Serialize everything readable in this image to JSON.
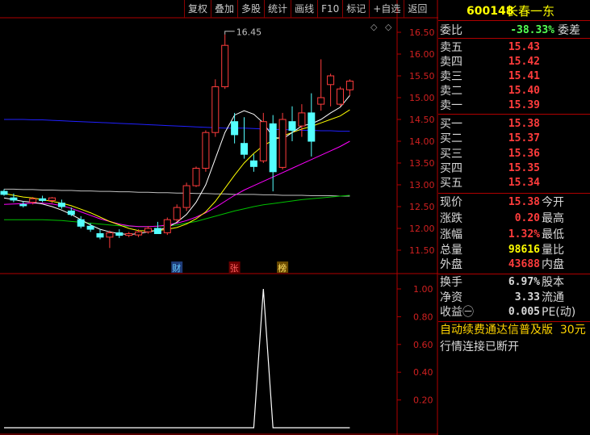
{
  "toolbar": [
    "复权",
    "叠加",
    "多股",
    "统计",
    "画线",
    "F10",
    "标记",
    "+自选",
    "返回"
  ],
  "stock": {
    "code": "600148",
    "name": "长春一东"
  },
  "weibi": {
    "label": "委比",
    "value": "-38.33%",
    "label2": "委差"
  },
  "sells": [
    {
      "label": "卖五",
      "price": "15.43"
    },
    {
      "label": "卖四",
      "price": "15.42"
    },
    {
      "label": "卖三",
      "price": "15.41"
    },
    {
      "label": "卖二",
      "price": "15.40"
    },
    {
      "label": "卖一",
      "price": "15.39"
    }
  ],
  "buys": [
    {
      "label": "买一",
      "price": "15.38"
    },
    {
      "label": "买二",
      "price": "15.37"
    },
    {
      "label": "买三",
      "price": "15.36"
    },
    {
      "label": "买四",
      "price": "15.35"
    },
    {
      "label": "买五",
      "price": "15.34"
    }
  ],
  "quote": [
    {
      "label": "现价",
      "value": "15.38",
      "label2": "今开"
    },
    {
      "label": "涨跌",
      "value": "0.20",
      "label2": "最高"
    },
    {
      "label": "涨幅",
      "value": "1.32%",
      "label2": "最低"
    },
    {
      "label": "总量",
      "value": "98616",
      "label2": "量比"
    },
    {
      "label": "外盘",
      "value": "43688",
      "label2": "内盘"
    }
  ],
  "fund": [
    {
      "label": "换手",
      "value": "6.97%",
      "label2": "股本"
    },
    {
      "label": "净资",
      "value": "3.33",
      "label2": "流通"
    },
    {
      "label": "收益㊀",
      "value": "0.005",
      "label2": "PE(动)"
    }
  ],
  "banner": "自动续费通达信普及版  30元",
  "status": "行情连接已断开",
  "peak_label": "16.45",
  "markers": [
    "财",
    "张",
    "榜"
  ],
  "colors": {
    "up": "#ff3c3c",
    "down": "#54ffff",
    "ma5": "#ffffff",
    "ma10": "#ffff00",
    "ma20": "#ff00ff",
    "ma60": "#00c000",
    "ma120": "#2020ff",
    "ma250": "#c0c0c0"
  },
  "chart_data": [
    {
      "type": "candlestick",
      "ylim": [
        11.25,
        16.7
      ],
      "yticks": [
        "16.50",
        "16.00",
        "15.50",
        "15.00",
        "14.50",
        "14.00",
        "13.50",
        "13.00",
        "12.50",
        "12.00",
        "11.50"
      ],
      "candles": [
        [
          12.85,
          12.9,
          12.75,
          12.78
        ],
        [
          12.7,
          12.8,
          12.6,
          12.65
        ],
        [
          12.55,
          12.62,
          12.48,
          12.52
        ],
        [
          12.6,
          12.72,
          12.55,
          12.68
        ],
        [
          12.68,
          12.75,
          12.6,
          12.64
        ],
        [
          12.64,
          12.72,
          12.58,
          12.7
        ],
        [
          12.58,
          12.66,
          12.45,
          12.5
        ],
        [
          12.4,
          12.48,
          12.28,
          12.32
        ],
        [
          12.2,
          12.28,
          12.0,
          12.05
        ],
        [
          12.05,
          12.12,
          11.92,
          11.98
        ],
        [
          11.88,
          11.98,
          11.75,
          11.8
        ],
        [
          11.8,
          11.95,
          11.55,
          11.9
        ],
        [
          11.9,
          11.98,
          11.78,
          11.84
        ],
        [
          11.84,
          11.92,
          11.8,
          11.88
        ],
        [
          11.85,
          11.98,
          11.8,
          11.92
        ],
        [
          11.92,
          12.05,
          11.88,
          12.0
        ],
        [
          12.0,
          12.15,
          11.9,
          11.88
        ],
        [
          11.9,
          12.25,
          11.85,
          12.2
        ],
        [
          12.2,
          12.55,
          12.15,
          12.48
        ],
        [
          12.48,
          13.05,
          12.4,
          12.98
        ],
        [
          12.98,
          13.42,
          12.95,
          13.38
        ],
        [
          13.38,
          14.25,
          13.3,
          14.2
        ],
        [
          14.2,
          15.42,
          14.1,
          15.25
        ],
        [
          15.25,
          16.45,
          15.2,
          16.2
        ],
        [
          14.45,
          14.65,
          13.95,
          14.15
        ],
        [
          13.95,
          14.55,
          13.6,
          13.7
        ],
        [
          13.55,
          13.7,
          13.3,
          13.42
        ],
        [
          13.55,
          14.65,
          13.5,
          14.45
        ],
        [
          14.4,
          14.6,
          12.85,
          13.3
        ],
        [
          13.4,
          14.65,
          13.35,
          14.5
        ],
        [
          14.45,
          14.8,
          14.0,
          14.25
        ],
        [
          14.35,
          14.85,
          14.1,
          14.65
        ],
        [
          14.65,
          15.1,
          13.65,
          14.0
        ],
        [
          14.85,
          15.88,
          14.7,
          15.0
        ],
        [
          15.3,
          15.55,
          14.8,
          15.5
        ],
        [
          14.85,
          15.25,
          14.8,
          15.2
        ],
        [
          15.18,
          15.42,
          15.05,
          15.38
        ]
      ],
      "ma5": [
        12.7,
        12.66,
        12.62,
        12.6,
        12.56,
        12.5,
        12.42,
        12.32,
        12.2,
        12.08,
        11.98,
        11.92,
        11.88,
        11.86,
        11.88,
        11.92,
        11.96,
        12.02,
        12.14,
        12.32,
        12.6,
        13.0,
        13.6,
        14.2,
        14.6,
        14.7,
        14.62,
        14.42,
        14.1,
        14.05,
        14.2,
        14.35,
        14.4,
        14.5,
        14.65,
        14.78,
        15.05
      ],
      "ma10": [
        12.8,
        12.76,
        12.72,
        12.7,
        12.66,
        12.62,
        12.58,
        12.52,
        12.44,
        12.36,
        12.26,
        12.16,
        12.08,
        12.0,
        11.95,
        11.94,
        11.95,
        11.98,
        12.02,
        12.1,
        12.22,
        12.38,
        12.62,
        12.92,
        13.22,
        13.5,
        13.72,
        13.9,
        14.02,
        14.12,
        14.2,
        14.28,
        14.34,
        14.42,
        14.5,
        14.58,
        14.72
      ],
      "ma20": [
        12.55,
        12.56,
        12.57,
        12.58,
        12.58,
        12.56,
        12.52,
        12.46,
        12.38,
        12.3,
        12.22,
        12.16,
        12.1,
        12.06,
        12.04,
        12.04,
        12.05,
        12.08,
        12.12,
        12.18,
        12.26,
        12.36,
        12.48,
        12.62,
        12.76,
        12.88,
        12.98,
        13.08,
        13.18,
        13.28,
        13.38,
        13.48,
        13.58,
        13.68,
        13.78,
        13.88,
        14.0
      ],
      "ma60": [
        12.2,
        12.2,
        12.2,
        12.2,
        12.2,
        12.19,
        12.18,
        12.16,
        12.14,
        12.12,
        12.1,
        12.08,
        12.06,
        12.05,
        12.04,
        12.04,
        12.05,
        12.06,
        12.08,
        12.12,
        12.16,
        12.22,
        12.28,
        12.34,
        12.4,
        12.45,
        12.5,
        12.54,
        12.57,
        12.6,
        12.63,
        12.66,
        12.68,
        12.7,
        12.72,
        12.74,
        12.76
      ],
      "ma120": [
        14.5,
        14.5,
        14.5,
        14.49,
        14.49,
        14.48,
        14.47,
        14.46,
        14.45,
        14.44,
        14.43,
        14.42,
        14.41,
        14.4,
        14.39,
        14.38,
        14.37,
        14.36,
        14.35,
        14.34,
        14.33,
        14.32,
        14.31,
        14.3,
        14.3,
        14.3,
        14.29,
        14.28,
        14.27,
        14.27,
        14.26,
        14.25,
        14.25,
        14.24,
        14.24,
        14.23,
        14.23
      ],
      "ma250": [
        12.9,
        12.9,
        12.89,
        12.89,
        12.88,
        12.88,
        12.87,
        12.87,
        12.86,
        12.86,
        12.85,
        12.85,
        12.84,
        12.84,
        12.83,
        12.83,
        12.82,
        12.82,
        12.81,
        12.81,
        12.8,
        12.8,
        12.79,
        12.79,
        12.78,
        12.78,
        12.78,
        12.77,
        12.77,
        12.76,
        12.76,
        12.76,
        12.75,
        12.75,
        12.75,
        12.74,
        12.74
      ]
    },
    {
      "type": "line",
      "ylim": [
        0,
        1.1
      ],
      "yticks": [
        "1.00",
        "0.80",
        "0.60",
        "0.40",
        "0.20"
      ],
      "x_index": [
        0,
        1,
        2,
        3,
        4,
        5,
        6,
        7,
        8,
        9,
        10,
        11,
        12,
        13,
        14,
        15,
        16,
        17,
        18,
        19,
        20,
        21,
        22,
        23,
        24,
        25,
        26,
        27,
        28,
        29,
        30,
        31,
        32,
        33,
        34,
        35,
        36
      ],
      "values": [
        0,
        0,
        0,
        0,
        0,
        0,
        0,
        0,
        0,
        0,
        0,
        0,
        0,
        0,
        0,
        0,
        0,
        0,
        0,
        0,
        0,
        0,
        0,
        0,
        0,
        0,
        0,
        1,
        0,
        0,
        0,
        0,
        0,
        0,
        0,
        0,
        0
      ]
    }
  ]
}
